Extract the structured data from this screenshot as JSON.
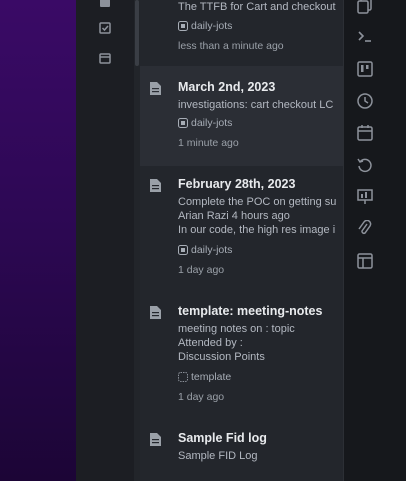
{
  "notes": [
    {
      "title": "",
      "lines": [
        "The TTFB for Cart and checkout"
      ],
      "tag": "daily-jots",
      "time": "less than a minute ago"
    },
    {
      "title": "March 2nd, 2023",
      "lines": [
        "investigations: cart checkout LC"
      ],
      "tag": "daily-jots",
      "time": "1 minute ago"
    },
    {
      "title": "February 28th, 2023",
      "lines": [
        "Complete the POC on getting su",
        "Arian Razi  4 hours ago",
        "In our code, the high res image i"
      ],
      "tag": "daily-jots",
      "time": "1 day ago"
    },
    {
      "title": "template: meeting-notes",
      "lines": [
        "meeting notes on : topic",
        "Attended by :",
        "Discussion Points"
      ],
      "tag": "template",
      "time": "1 day ago"
    },
    {
      "title": "Sample Fid log",
      "lines": [
        "Sample FID Log"
      ],
      "tag": "",
      "time": ""
    }
  ],
  "icons": {
    "rail": [
      "document-icon",
      "checklist-icon",
      "calendar-icon"
    ],
    "right": [
      "copy-icon",
      "terminal-icon",
      "kanban-icon",
      "clock-icon",
      "calendar-icon",
      "history-icon",
      "presentation-icon",
      "paperclip-icon",
      "layout-icon"
    ]
  },
  "colors": {
    "accent_bg": "#2d0854",
    "panel": "#23262c",
    "sidebar": "#16181c"
  }
}
